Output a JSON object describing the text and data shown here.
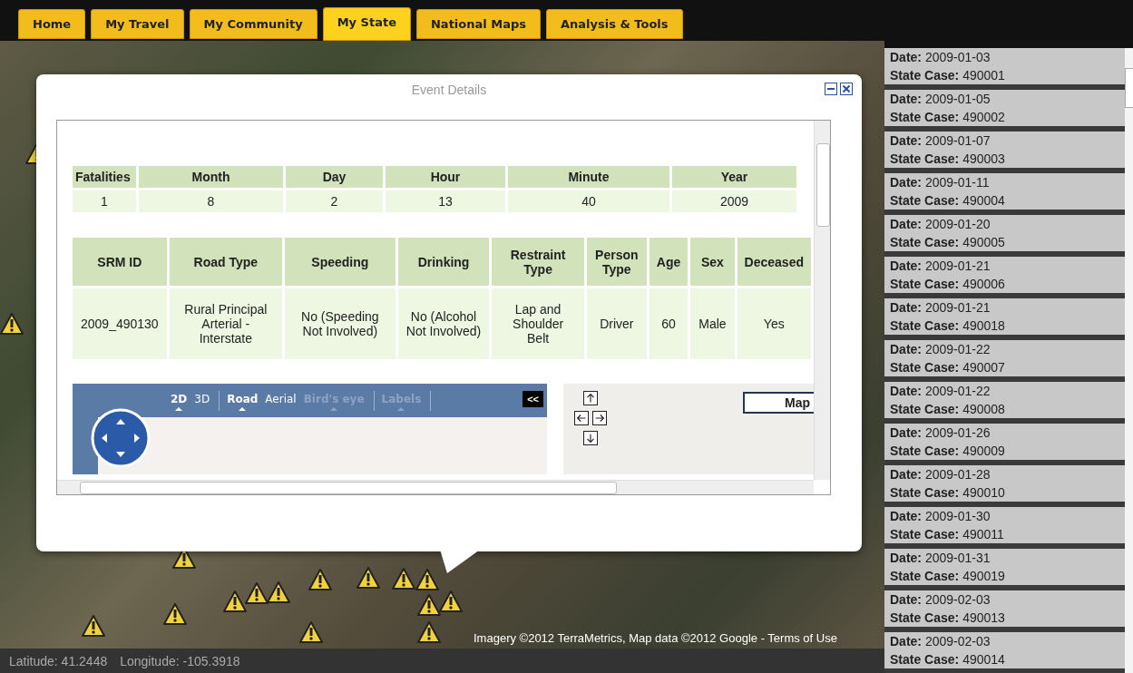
{
  "nav_tabs": [
    {
      "label": "Home",
      "selected": false
    },
    {
      "label": "My Travel",
      "selected": false
    },
    {
      "label": "My Community",
      "selected": false
    },
    {
      "label": "My State",
      "selected": true
    },
    {
      "label": "National Maps",
      "selected": false
    },
    {
      "label": "Analysis & Tools",
      "selected": false
    }
  ],
  "map": {
    "attribution": "Imagery ©2012 TerraMetrics, Map data ©2012 Google -",
    "terms_link": "Terms of Use"
  },
  "event_details": {
    "title": "Event Details",
    "summary_table": {
      "columns": [
        "Fatalities",
        "Month",
        "Day",
        "Hour",
        "Minute",
        "Year"
      ],
      "rows": [
        [
          "1",
          "8",
          "2",
          "13",
          "40",
          "2009"
        ]
      ]
    },
    "person_table": {
      "columns": [
        "SRM ID",
        "Road Type",
        "Speeding",
        "Drinking",
        "Restraint Type",
        "Person Type",
        "Age",
        "Sex",
        "Deceased"
      ],
      "rows": [
        [
          "2009_490130",
          "Rural Principal Arterial - Interstate",
          "No (Speeding Not Involved)",
          "No (Alcohol Not Involved)",
          "Lap and Shoulder Belt",
          "Driver",
          "60",
          "Male",
          "Yes"
        ]
      ]
    },
    "embedded_map": {
      "mode_groups": [
        [
          {
            "label": "2D",
            "selected": true,
            "disabled": false
          },
          {
            "label": "3D",
            "selected": false,
            "disabled": false
          }
        ],
        [
          {
            "label": "Road",
            "selected": true,
            "disabled": false
          },
          {
            "label": "Aerial",
            "selected": false,
            "disabled": false
          },
          {
            "label": "Bird's eye",
            "selected": false,
            "disabled": true
          }
        ],
        [
          {
            "label": "Labels",
            "selected": false,
            "disabled": true
          }
        ]
      ],
      "collapse_button": "<<",
      "map_type_button": "Map"
    }
  },
  "case_list": [
    {
      "date": "**Date:** 2009-01-03",
      "state_case": "**State Case:** 490001"
    },
    {
      "date": "**Date:** 2009-01-05",
      "state_case": "**State Case:** 490002"
    },
    {
      "date": "**Date:** 2009-01-07",
      "state_case": "**State Case:** 490003"
    },
    {
      "date": "**Date:** 2009-01-11",
      "state_case": "**State Case:** 490004"
    },
    {
      "date": "**Date:** 2009-01-20",
      "state_case": "**State Case:** 490005"
    },
    {
      "date": "**Date:** 2009-01-21",
      "state_case": "**State Case:** 490006"
    },
    {
      "date": "**Date:** 2009-01-21",
      "state_case": "**State Case:** 490018"
    },
    {
      "date": "**Date:** 2009-01-22",
      "state_case": "**State Case:** 490007"
    },
    {
      "date": "**Date:** 2009-01-22",
      "state_case": "**State Case:** 490008"
    },
    {
      "date": "**Date:** 2009-01-26",
      "state_case": "**State Case:** 490009"
    },
    {
      "date": "**Date:** 2009-01-28",
      "state_case": "**State Case:** 490010"
    },
    {
      "date": "**Date:** 2009-01-30",
      "state_case": "**State Case:** 490011"
    },
    {
      "date": "**Date:** 2009-01-31",
      "state_case": "**State Case:** 490019"
    },
    {
      "date": "**Date:** 2009-02-03",
      "state_case": "**State Case:** 490013"
    },
    {
      "date": "**Date:** 2009-02-03",
      "state_case": "**State Case:** 490014"
    }
  ],
  "status_bar": {
    "latitude": "Latitude: 41.2448",
    "longitude": "Longitude: -105.3918"
  }
}
